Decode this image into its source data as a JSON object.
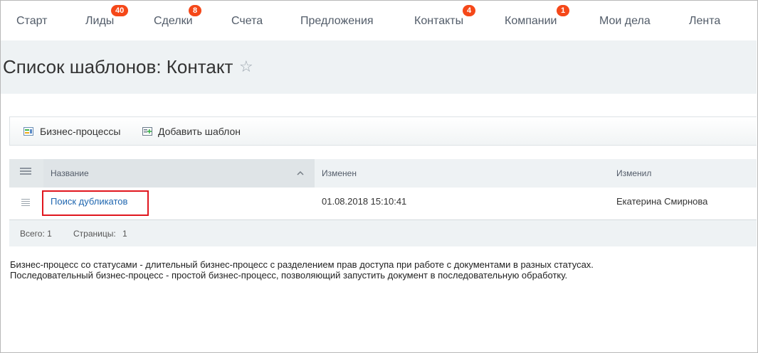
{
  "nav": {
    "items": [
      {
        "label": "Старт",
        "badge": null
      },
      {
        "label": "Лиды",
        "badge": "40"
      },
      {
        "label": "Сделки",
        "badge": "8"
      },
      {
        "label": "Счета",
        "badge": null
      },
      {
        "label": "Предложения",
        "badge": null
      },
      {
        "label": "Контакты",
        "badge": "4"
      },
      {
        "label": "Компании",
        "badge": "1"
      },
      {
        "label": "Мои дела",
        "badge": null
      },
      {
        "label": "Лента",
        "badge": null
      }
    ]
  },
  "page": {
    "title": "Список шаблонов: Контакт",
    "star_icon": "☆"
  },
  "toolbar": {
    "business_processes_label": "Бизнес-процессы",
    "add_template_label": "Добавить шаблон"
  },
  "grid": {
    "columns": [
      "Название",
      "Изменен",
      "Изменил"
    ],
    "sort_indicator": "^",
    "rows": [
      {
        "name": "Поиск дубликатов",
        "modified": "01.08.2018 15:10:41",
        "modified_by": "Екатерина Смирнова"
      }
    ],
    "footer": {
      "total_label": "Всего: 1",
      "pages_label": "Страницы:",
      "pages_value": "1"
    }
  },
  "description": {
    "line1": "Бизнес-процесс со статусами - длительный бизнес-процесс с разделением прав доступа при работе с документами в разных статусах.",
    "line2": "Последовательный бизнес-процесс - простой бизнес-процесс, позволяющий запустить документ в последовательную обработку."
  },
  "colors": {
    "badge": "#f54819",
    "link": "#2067b0",
    "highlight_border": "#e0161e",
    "band": "#eef2f4"
  }
}
